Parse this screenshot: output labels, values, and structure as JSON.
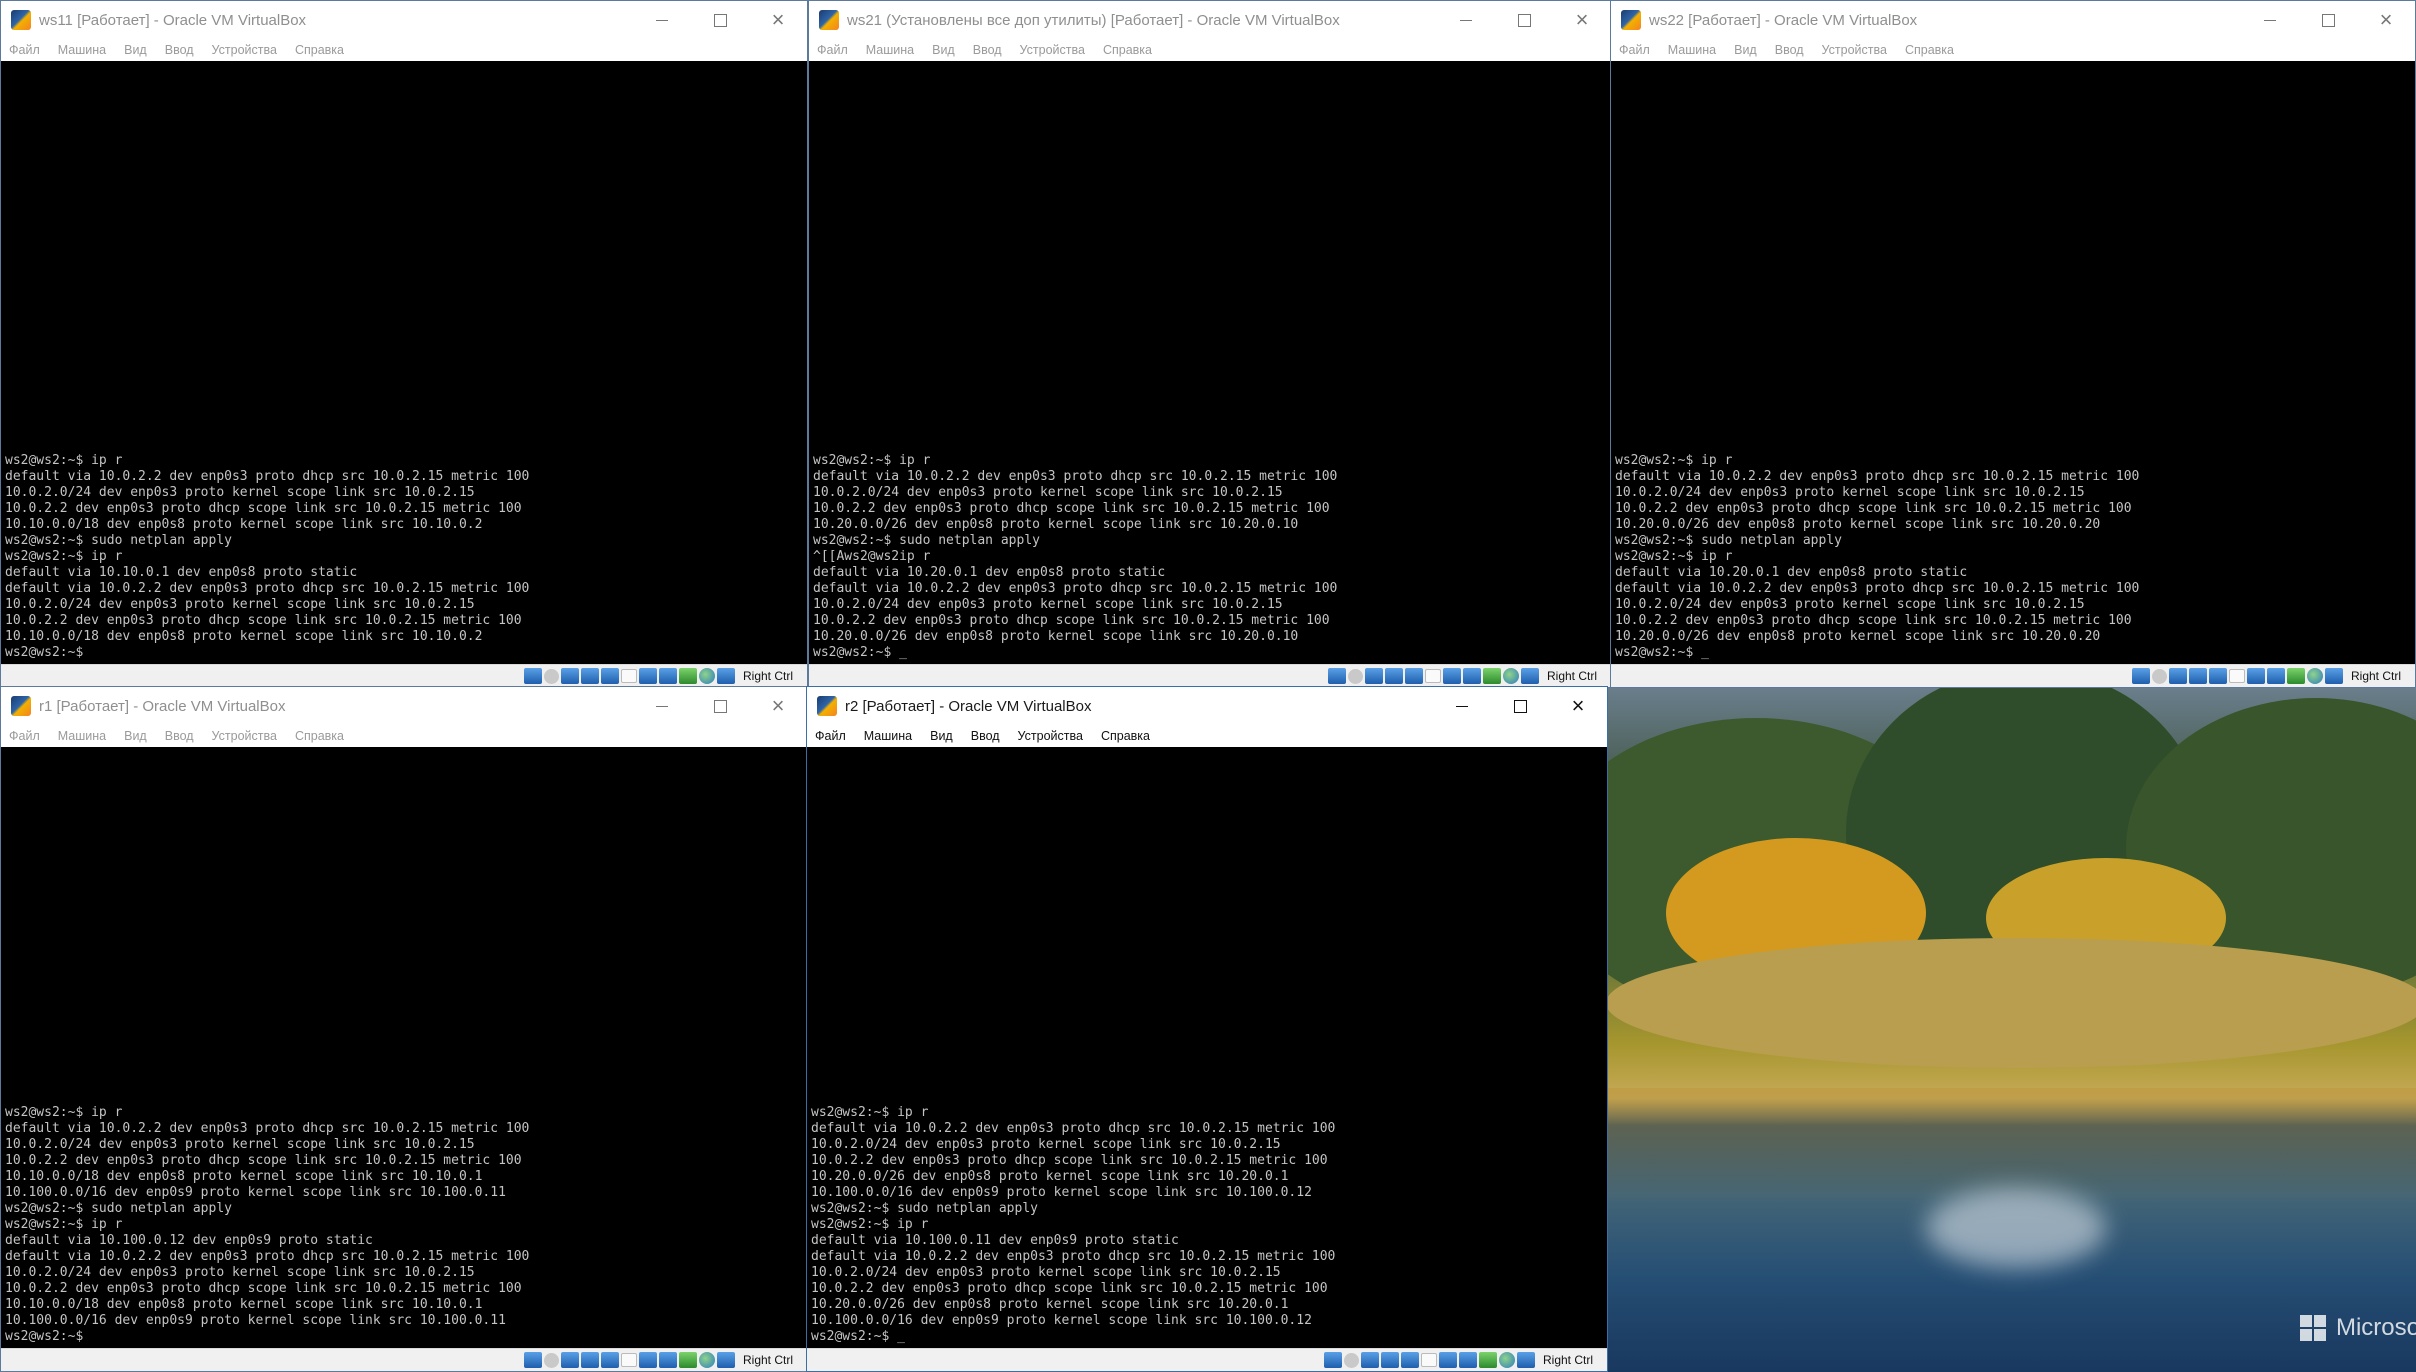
{
  "desktop": {
    "watermark": "Microsoft E"
  },
  "menu_labels": [
    "Файл",
    "Машина",
    "Вид",
    "Ввод",
    "Устройства",
    "Справка"
  ],
  "windows": [
    {
      "title": "ws11 [Работает] - Oracle VM VirtualBox",
      "host_key": "Right Ctrl",
      "console": "ws2@ws2:~$ ip r\ndefault via 10.0.2.2 dev enp0s3 proto dhcp src 10.0.2.15 metric 100\n10.0.2.0/24 dev enp0s3 proto kernel scope link src 10.0.2.15\n10.0.2.2 dev enp0s3 proto dhcp scope link src 10.0.2.15 metric 100\n10.10.0.0/18 dev enp0s8 proto kernel scope link src 10.10.0.2\nws2@ws2:~$ sudo netplan apply\nws2@ws2:~$ ip r\ndefault via 10.10.0.1 dev enp0s8 proto static\ndefault via 10.0.2.2 dev enp0s3 proto dhcp src 10.0.2.15 metric 100\n10.0.2.0/24 dev enp0s3 proto kernel scope link src 10.0.2.15\n10.0.2.2 dev enp0s3 proto dhcp scope link src 10.0.2.15 metric 100\n10.10.0.0/18 dev enp0s8 proto kernel scope link src 10.10.0.2\nws2@ws2:~$"
    },
    {
      "title": "ws21 (Установлены все доп утилиты) [Работает] - Oracle VM VirtualBox",
      "host_key": "Right Ctrl",
      "console": "ws2@ws2:~$ ip r\ndefault via 10.0.2.2 dev enp0s3 proto dhcp src 10.0.2.15 metric 100\n10.0.2.0/24 dev enp0s3 proto kernel scope link src 10.0.2.15\n10.0.2.2 dev enp0s3 proto dhcp scope link src 10.0.2.15 metric 100\n10.20.0.0/26 dev enp0s8 proto kernel scope link src 10.20.0.10\nws2@ws2:~$ sudo netplan apply\n^[[Aws2@ws2ip r\ndefault via 10.20.0.1 dev enp0s8 proto static\ndefault via 10.0.2.2 dev enp0s3 proto dhcp src 10.0.2.15 metric 100\n10.0.2.0/24 dev enp0s3 proto kernel scope link src 10.0.2.15\n10.0.2.2 dev enp0s3 proto dhcp scope link src 10.0.2.15 metric 100\n10.20.0.0/26 dev enp0s8 proto kernel scope link src 10.20.0.10\nws2@ws2:~$ _"
    },
    {
      "title": "ws22 [Работает] - Oracle VM VirtualBox",
      "host_key": "Right Ctrl",
      "console": "ws2@ws2:~$ ip r\ndefault via 10.0.2.2 dev enp0s3 proto dhcp src 10.0.2.15 metric 100\n10.0.2.0/24 dev enp0s3 proto kernel scope link src 10.0.2.15\n10.0.2.2 dev enp0s3 proto dhcp scope link src 10.0.2.15 metric 100\n10.20.0.0/26 dev enp0s8 proto kernel scope link src 10.20.0.20\nws2@ws2:~$ sudo netplan apply\nws2@ws2:~$ ip r\ndefault via 10.20.0.1 dev enp0s8 proto static\ndefault via 10.0.2.2 dev enp0s3 proto dhcp src 10.0.2.15 metric 100\n10.0.2.0/24 dev enp0s3 proto kernel scope link src 10.0.2.15\n10.0.2.2 dev enp0s3 proto dhcp scope link src 10.0.2.15 metric 100\n10.20.0.0/26 dev enp0s8 proto kernel scope link src 10.20.0.20\nws2@ws2:~$ _"
    },
    {
      "title": "r1 [Работает] - Oracle VM VirtualBox",
      "host_key": "Right Ctrl",
      "console": "ws2@ws2:~$ ip r\ndefault via 10.0.2.2 dev enp0s3 proto dhcp src 10.0.2.15 metric 100\n10.0.2.0/24 dev enp0s3 proto kernel scope link src 10.0.2.15\n10.0.2.2 dev enp0s3 proto dhcp scope link src 10.0.2.15 metric 100\n10.10.0.0/18 dev enp0s8 proto kernel scope link src 10.10.0.1\n10.100.0.0/16 dev enp0s9 proto kernel scope link src 10.100.0.11\nws2@ws2:~$ sudo netplan apply\nws2@ws2:~$ ip r\ndefault via 10.100.0.12 dev enp0s9 proto static\ndefault via 10.0.2.2 dev enp0s3 proto dhcp src 10.0.2.15 metric 100\n10.0.2.0/24 dev enp0s3 proto kernel scope link src 10.0.2.15\n10.0.2.2 dev enp0s3 proto dhcp scope link src 10.0.2.15 metric 100\n10.10.0.0/18 dev enp0s8 proto kernel scope link src 10.10.0.1\n10.100.0.0/16 dev enp0s9 proto kernel scope link src 10.100.0.11\nws2@ws2:~$"
    },
    {
      "title": "r2 [Работает] - Oracle VM VirtualBox",
      "host_key": "Right Ctrl",
      "console": "ws2@ws2:~$ ip r\ndefault via 10.0.2.2 dev enp0s3 proto dhcp src 10.0.2.15 metric 100\n10.0.2.0/24 dev enp0s3 proto kernel scope link src 10.0.2.15\n10.0.2.2 dev enp0s3 proto dhcp scope link src 10.0.2.15 metric 100\n10.20.0.0/26 dev enp0s8 proto kernel scope link src 10.20.0.1\n10.100.0.0/16 dev enp0s9 proto kernel scope link src 10.100.0.12\nws2@ws2:~$ sudo netplan apply\nws2@ws2:~$ ip r\ndefault via 10.100.0.11 dev enp0s9 proto static\ndefault via 10.0.2.2 dev enp0s3 proto dhcp src 10.0.2.15 metric 100\n10.0.2.0/24 dev enp0s3 proto kernel scope link src 10.0.2.15\n10.0.2.2 dev enp0s3 proto dhcp scope link src 10.0.2.15 metric 100\n10.20.0.0/26 dev enp0s8 proto kernel scope link src 10.20.0.1\n10.100.0.0/16 dev enp0s9 proto kernel scope link src 10.100.0.12\nws2@ws2:~$ _"
    }
  ]
}
